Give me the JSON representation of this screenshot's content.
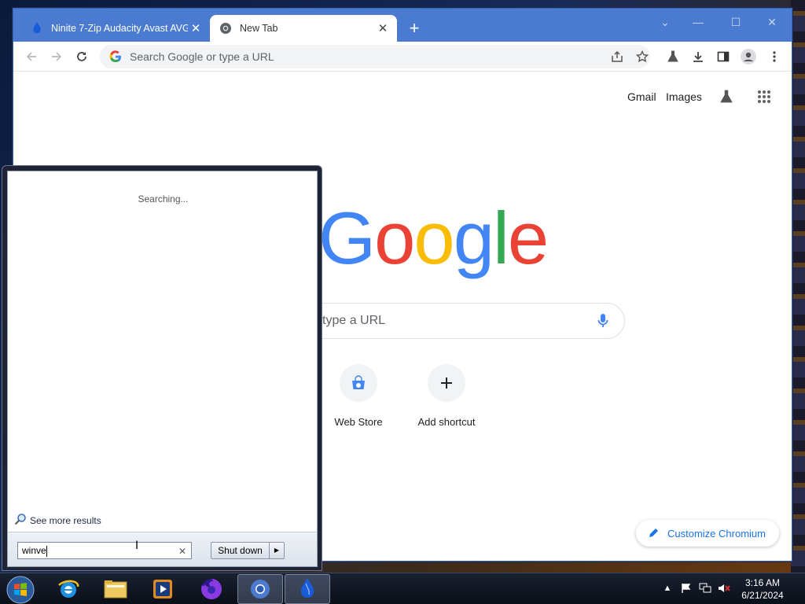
{
  "browser": {
    "tabs": [
      {
        "label": "Ninite 7-Zip Audacity Avast AVG",
        "active": false
      },
      {
        "label": "New Tab",
        "active": true
      }
    ],
    "omnibox_placeholder": "Search Google or type a URL",
    "accent": "#4a7bd0"
  },
  "ntp": {
    "links": {
      "gmail": "Gmail",
      "images": "Images"
    },
    "logo_letters": [
      "G",
      "o",
      "o",
      "g",
      "l",
      "e"
    ],
    "logo_colors": [
      "#4285f4",
      "#ea4335",
      "#fbbc05",
      "#4285f4",
      "#34a853",
      "#ea4335"
    ],
    "search_placeholder_visible": "type a URL",
    "shortcuts": [
      {
        "label": "Web Store",
        "icon": "web-store-icon"
      },
      {
        "label": "Add shortcut",
        "icon": "plus-icon"
      }
    ],
    "customize_label": "Customize Chromium"
  },
  "startmenu": {
    "status": "Searching...",
    "see_more": "See more results",
    "search_value": "winve",
    "shutdown_label": "Shut down"
  },
  "taskbar": {
    "apps": [
      "windows-start-orb",
      "internet-explorer-icon",
      "file-explorer-icon",
      "media-player-icon",
      "firefox-icon",
      "chromium-icon",
      "ninite-icon"
    ],
    "clock_time": "3:16 AM",
    "clock_date": "6/21/2024"
  }
}
